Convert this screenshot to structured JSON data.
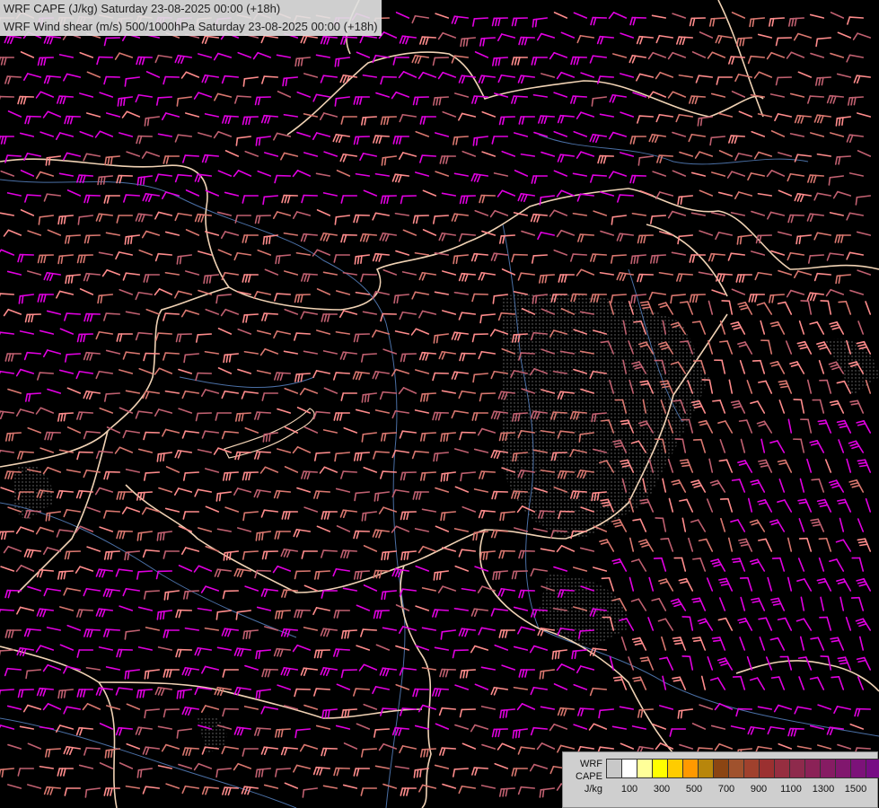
{
  "header": {
    "line1": "WRF CAPE (J/kg) Saturday 23-08-2025 00:00 (+18h)",
    "line2": "WRF Wind shear (m/s) 500/1000hPa Saturday 23-08-2025 00:00 (+18h)"
  },
  "legend": {
    "line1": "WRF",
    "line2": "CAPE",
    "line3": "J/kg",
    "colors": [
      "#c8c8c8",
      "#ffffff",
      "#ffff99",
      "#ffff00",
      "#ffcc00",
      "#ff9900",
      "#b8860b",
      "#8b4513",
      "#a0522d",
      "#a0412d",
      "#9b3030",
      "#962e40",
      "#8e2a4c",
      "#8b2257",
      "#861c63",
      "#81176e",
      "#7c1279",
      "#770c84"
    ],
    "ticks": [
      "100",
      "300",
      "500",
      "700",
      "900",
      "1100",
      "1300",
      "1500"
    ]
  },
  "barb_colors": {
    "magenta": "#e100e1",
    "light_pink": "#ff8c8c",
    "salmon": "#d9776f",
    "rose": "#c06070"
  },
  "map_colors": {
    "background": "#000000",
    "borders": "#f0d2b4",
    "rivers": "#4a6fa5",
    "terrain_stipple": "#9a9a9a"
  }
}
